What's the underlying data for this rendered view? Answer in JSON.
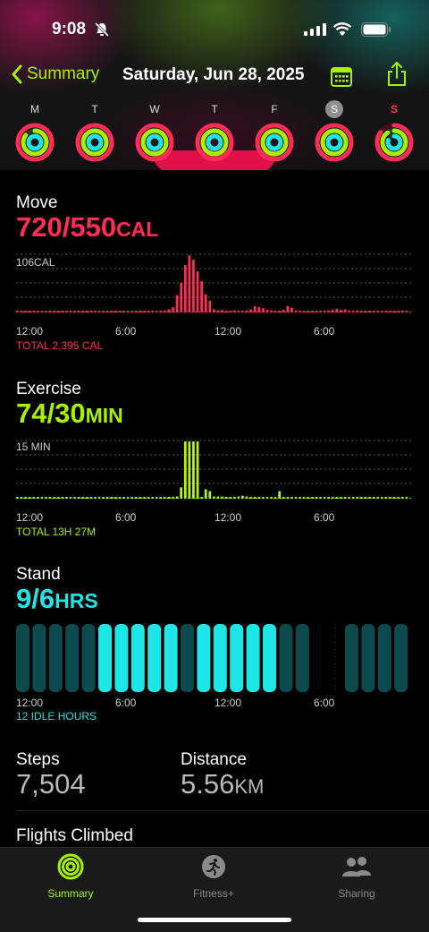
{
  "status_bar": {
    "time": "9:08"
  },
  "nav": {
    "back_label": "Summary",
    "date": "Saturday, Jun 28, 2025"
  },
  "week": [
    {
      "label": "M",
      "move": 1.0,
      "exercise": 0.85,
      "stand": 1.0,
      "selected": false,
      "today": false
    },
    {
      "label": "T",
      "move": 1.0,
      "exercise": 1.0,
      "stand": 1.0,
      "selected": false,
      "today": false
    },
    {
      "label": "W",
      "move": 1.0,
      "exercise": 1.0,
      "stand": 1.0,
      "selected": false,
      "today": false
    },
    {
      "label": "T",
      "move": 1.0,
      "exercise": 1.0,
      "stand": 1.0,
      "selected": false,
      "today": false
    },
    {
      "label": "F",
      "move": 1.0,
      "exercise": 1.0,
      "stand": 1.0,
      "selected": false,
      "today": false
    },
    {
      "label": "S",
      "move": 1.0,
      "exercise": 1.0,
      "stand": 1.0,
      "selected": true,
      "today": false
    },
    {
      "label": "S",
      "move": 0.85,
      "exercise": 0.9,
      "stand": 0.8,
      "selected": false,
      "today": true
    }
  ],
  "move": {
    "title": "Move",
    "value": "720/550",
    "unit": "CAL",
    "color": "#ff2d55",
    "chart_max_label": "106CAL",
    "x_labels": [
      "12:00",
      "6:00",
      "12:00",
      "6:00"
    ],
    "total": "TOTAL 2,395 CAL"
  },
  "exercise": {
    "title": "Exercise",
    "value": "74/30",
    "unit": "MIN",
    "color": "#a6f000",
    "chart_max_label": "15 MIN",
    "x_labels": [
      "12:00",
      "6:00",
      "12:00",
      "6:00"
    ],
    "total": "TOTAL 13H 27M"
  },
  "stand": {
    "title": "Stand",
    "value": "9/6",
    "unit": "HRS",
    "color": "#1ee6e6",
    "x_labels": [
      "12:00",
      "6:00",
      "12:00",
      "6:00"
    ],
    "total": "12 IDLE HOURS"
  },
  "steps": {
    "title": "Steps",
    "value": "7,504"
  },
  "distance": {
    "title": "Distance",
    "value": "5.56",
    "unit": "KM"
  },
  "flights": {
    "title": "Flights Climbed"
  },
  "tabs": [
    {
      "label": "Summary",
      "active": true,
      "icon": "activity-rings-icon"
    },
    {
      "label": "Fitness+",
      "active": false,
      "icon": "fitness-plus-runner-icon"
    },
    {
      "label": "Sharing",
      "active": false,
      "icon": "sharing-people-icon"
    }
  ],
  "chart_data": [
    {
      "type": "bar",
      "title": "Move",
      "unit": "CAL",
      "ylim": [
        0,
        106
      ],
      "x_ticks": [
        "12:00",
        "6:00",
        "12:00",
        "6:00"
      ],
      "values": [
        2,
        2,
        2,
        2,
        2,
        2,
        2,
        2,
        2,
        2,
        2,
        2,
        2,
        2,
        2,
        2,
        2,
        2,
        2,
        2,
        2,
        2,
        2,
        2,
        2,
        2,
        2,
        2,
        2,
        2,
        2,
        2,
        2,
        2,
        3,
        3,
        4,
        6,
        10,
        32,
        55,
        88,
        106,
        98,
        76,
        58,
        34,
        22,
        6,
        4,
        5,
        3,
        3,
        4,
        3,
        3,
        4,
        6,
        12,
        10,
        8,
        5,
        4,
        3,
        3,
        5,
        12,
        9,
        4,
        3,
        3,
        3,
        3,
        3,
        3,
        4,
        4,
        5,
        7,
        5,
        6,
        4,
        3,
        4,
        2,
        2,
        2,
        2,
        2,
        2,
        2,
        2,
        2,
        2,
        2,
        2
      ]
    },
    {
      "type": "bar",
      "title": "Exercise",
      "unit": "MIN",
      "ylim": [
        0,
        15
      ],
      "x_ticks": [
        "12:00",
        "6:00",
        "12:00",
        "6:00"
      ],
      "values": [
        0.3,
        0.3,
        0.3,
        0.3,
        0.3,
        0.3,
        0.3,
        0.3,
        0.3,
        0.3,
        0.3,
        0.3,
        0.3,
        0.3,
        0.3,
        0.3,
        0.3,
        0.3,
        0.3,
        0.3,
        0.3,
        0.3,
        0.3,
        0.3,
        0.3,
        0.3,
        0.3,
        0.3,
        0.3,
        0.3,
        0.3,
        0.3,
        0.3,
        0.3,
        0.3,
        0.3,
        0.4,
        0.5,
        0.5,
        0.6,
        3,
        15,
        15,
        15,
        15,
        0.5,
        2.5,
        2,
        0.6,
        0.6,
        0.6,
        0.5,
        0.5,
        0.5,
        0.6,
        0.8,
        0.6,
        0.5,
        0.5,
        0.4,
        0.4,
        0.4,
        0.4,
        0.4,
        2,
        0.4,
        0.4,
        0.4,
        0.3,
        0.3,
        0.3,
        0.3,
        0.3,
        0.3,
        0.3,
        0.3,
        0.3,
        0.3,
        0.3,
        0.3,
        0.3,
        0.3,
        0.3,
        0.3,
        0.3,
        0.3,
        0.3,
        0.3,
        0.3,
        0.3,
        0.3,
        0.3,
        0.3,
        0.3,
        0.3,
        0.3
      ]
    },
    {
      "type": "bar",
      "title": "Stand",
      "unit": "HRS",
      "x_ticks": [
        "12:00",
        "6:00",
        "12:00",
        "6:00"
      ],
      "values": [
        0,
        0,
        0,
        0,
        0,
        1,
        1,
        1,
        1,
        1,
        0,
        1,
        1,
        1,
        1,
        1,
        0,
        0,
        null,
        null,
        0,
        0,
        0,
        0
      ]
    }
  ]
}
